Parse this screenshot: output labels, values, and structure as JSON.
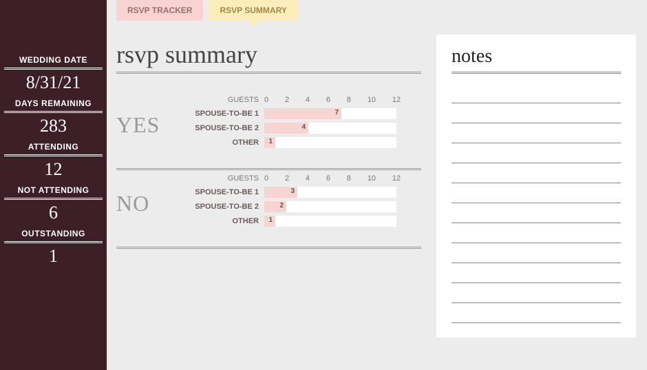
{
  "sidebar": {
    "stats": [
      {
        "label": "WEDDING DATE",
        "value": "8/31/21"
      },
      {
        "label": "DAYS REMAINING",
        "value": "283"
      },
      {
        "label": "ATTENDING",
        "value": "12"
      },
      {
        "label": "NOT ATTENDING",
        "value": "6"
      },
      {
        "label": "OUTSTANDING",
        "value": "1"
      }
    ]
  },
  "tabs": [
    {
      "label": "RSVP TRACKER",
      "active": false
    },
    {
      "label": "RSVP SUMMARY",
      "active": true
    }
  ],
  "page_title": "rsvp summary",
  "chart_header": "GUESTS",
  "ticks": [
    "0",
    "2",
    "4",
    "6",
    "8",
    "10",
    "12"
  ],
  "row_labels": [
    "SPOUSE-TO-BE 1",
    "SPOUSE-TO-BE 2",
    "OTHER"
  ],
  "yes_heading": "YES",
  "no_heading": "NO",
  "notes_title": "notes",
  "notes_line_count": 12,
  "chart_data": [
    {
      "type": "bar",
      "title": "YES",
      "xlabel": "",
      "ylabel": "GUESTS",
      "xlim": [
        0,
        12
      ],
      "categories": [
        "SPOUSE-TO-BE 1",
        "SPOUSE-TO-BE 2",
        "OTHER"
      ],
      "values": [
        7,
        4,
        1
      ]
    },
    {
      "type": "bar",
      "title": "NO",
      "xlabel": "",
      "ylabel": "GUESTS",
      "xlim": [
        0,
        12
      ],
      "categories": [
        "SPOUSE-TO-BE 1",
        "SPOUSE-TO-BE 2",
        "OTHER"
      ],
      "values": [
        3,
        2,
        1
      ]
    }
  ]
}
